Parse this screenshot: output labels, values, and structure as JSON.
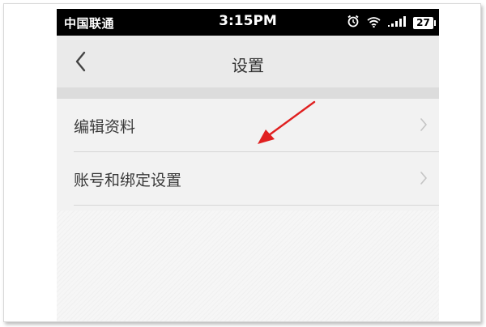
{
  "status_bar": {
    "carrier": "中国联通",
    "time": "3:15PM",
    "battery": "27"
  },
  "nav": {
    "title": "设置"
  },
  "menu": {
    "items": [
      {
        "label": "编辑资料"
      },
      {
        "label": "账号和绑定设置"
      }
    ]
  },
  "colors": {
    "annotation_arrow": "#e02020"
  }
}
